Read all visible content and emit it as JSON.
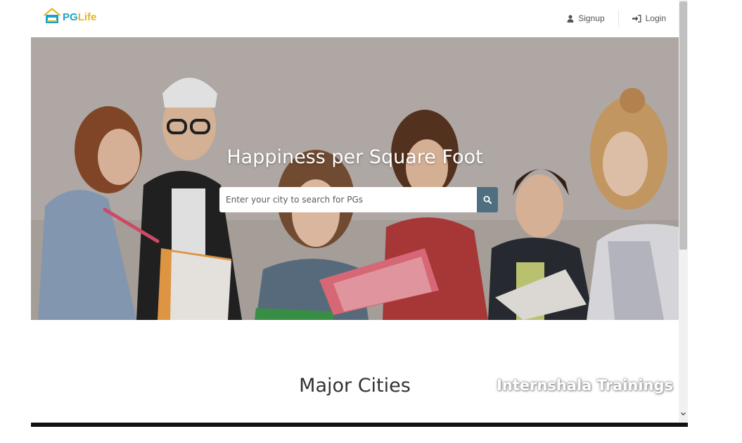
{
  "brand": {
    "pg": "PG",
    "life": "Life"
  },
  "nav": {
    "signup": "Signup",
    "login": "Login"
  },
  "hero": {
    "title": "Happiness per Square Foot",
    "search_placeholder": "Enter your city to search for PGs"
  },
  "section": {
    "title": "Major Cities"
  },
  "watermark": "Internshala Trainings",
  "icons": {
    "logo": "house-logo-icon",
    "signup": "user-icon",
    "login": "sign-in-icon",
    "search": "search-icon",
    "scroll_down": "chevron-down-icon"
  },
  "colors": {
    "brand_blue": "#1aa3c9",
    "brand_yellow": "#e5b520",
    "search_button": "#4f6f80"
  }
}
